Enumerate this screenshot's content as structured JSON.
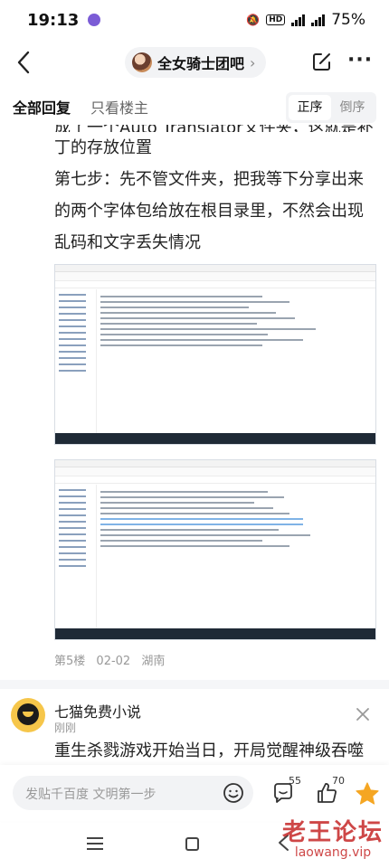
{
  "status_bar": {
    "time": "19:13",
    "battery": "75%"
  },
  "header": {
    "forum_name": "全女骑士团吧"
  },
  "filter": {
    "all_replies": "全部回复",
    "host_only": "只看楼主",
    "sort_asc": "正序",
    "sort_desc": "倒序"
  },
  "post": {
    "partial_line": "成了一个Auto Translator文件夹，这就是补",
    "lines": [
      "丁的存放位置",
      "第七步：先不管文件夹，把我等下分享出来",
      "的两个字体包给放在根目录里，不然会出现",
      "乱码和文字丢失情况"
    ],
    "floor": "第5楼",
    "date": "02-02",
    "location": "湖南"
  },
  "comment": {
    "user": "七猫免费小说",
    "time": "刚刚",
    "text": "重生杀戮游戏开始当日，开局觉醒神级吞噬"
  },
  "reply_bar": {
    "placeholder": "发贴千百度 文明第一步",
    "comments_count": "55",
    "likes_count": "70"
  },
  "watermark": {
    "cn": "老王论坛",
    "url": "laowang.vip"
  }
}
